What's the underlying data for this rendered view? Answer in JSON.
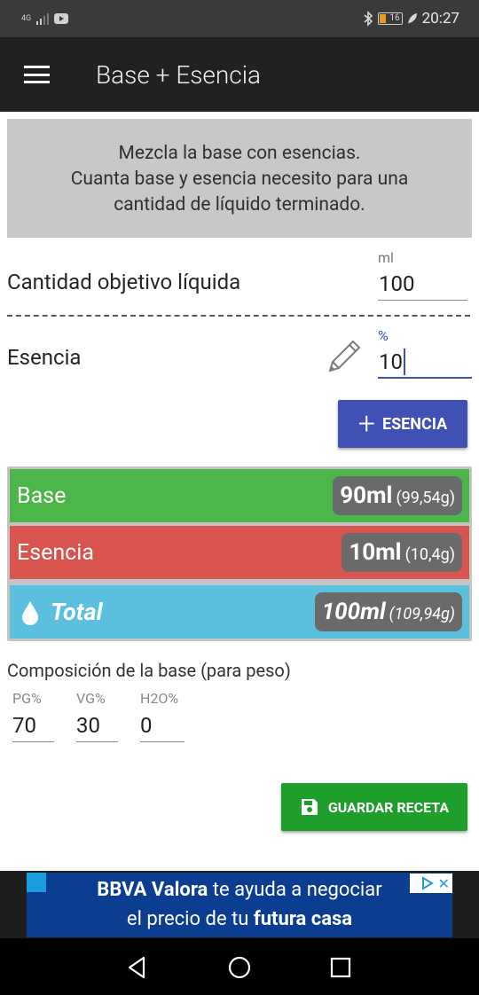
{
  "status_bar": {
    "network": "4G",
    "battery": "16",
    "time": "20:27"
  },
  "app_bar": {
    "title": "Base + Esencia"
  },
  "info": {
    "line1": "Mezcla la base con esencias.",
    "line2": "Cuanta base y esencia necesito para una",
    "line3": "cantidad de líquido terminado."
  },
  "target": {
    "label": "Cantidad objetivo líquida",
    "unit": "ml",
    "value": "100"
  },
  "essence": {
    "label": "Esencia",
    "unit": "%",
    "value": "10",
    "add_button": "ESENCIA"
  },
  "results": {
    "base": {
      "label": "Base",
      "ml": "90ml",
      "g": "(99,54g)",
      "color": "#4cb748"
    },
    "essence": {
      "label": "Esencia",
      "ml": "10ml",
      "g": "(10,4g)",
      "color": "#d9534f"
    },
    "total": {
      "label": "Total",
      "ml": "100ml",
      "g": "(109,94g)",
      "color": "#5bc0de"
    }
  },
  "composition": {
    "title": "Composición de la base (para peso)",
    "pg_label": "PG%",
    "pg_value": "70",
    "vg_label": "VG%",
    "vg_value": "30",
    "h2o_label": "H2O%",
    "h2o_value": "0"
  },
  "save_button": "GUARDAR RECETA",
  "ad": {
    "brand": "BBVA Valora",
    "text1": " te ayuda a negociar",
    "text2": "el precio de tu ",
    "text3": "futura casa"
  }
}
